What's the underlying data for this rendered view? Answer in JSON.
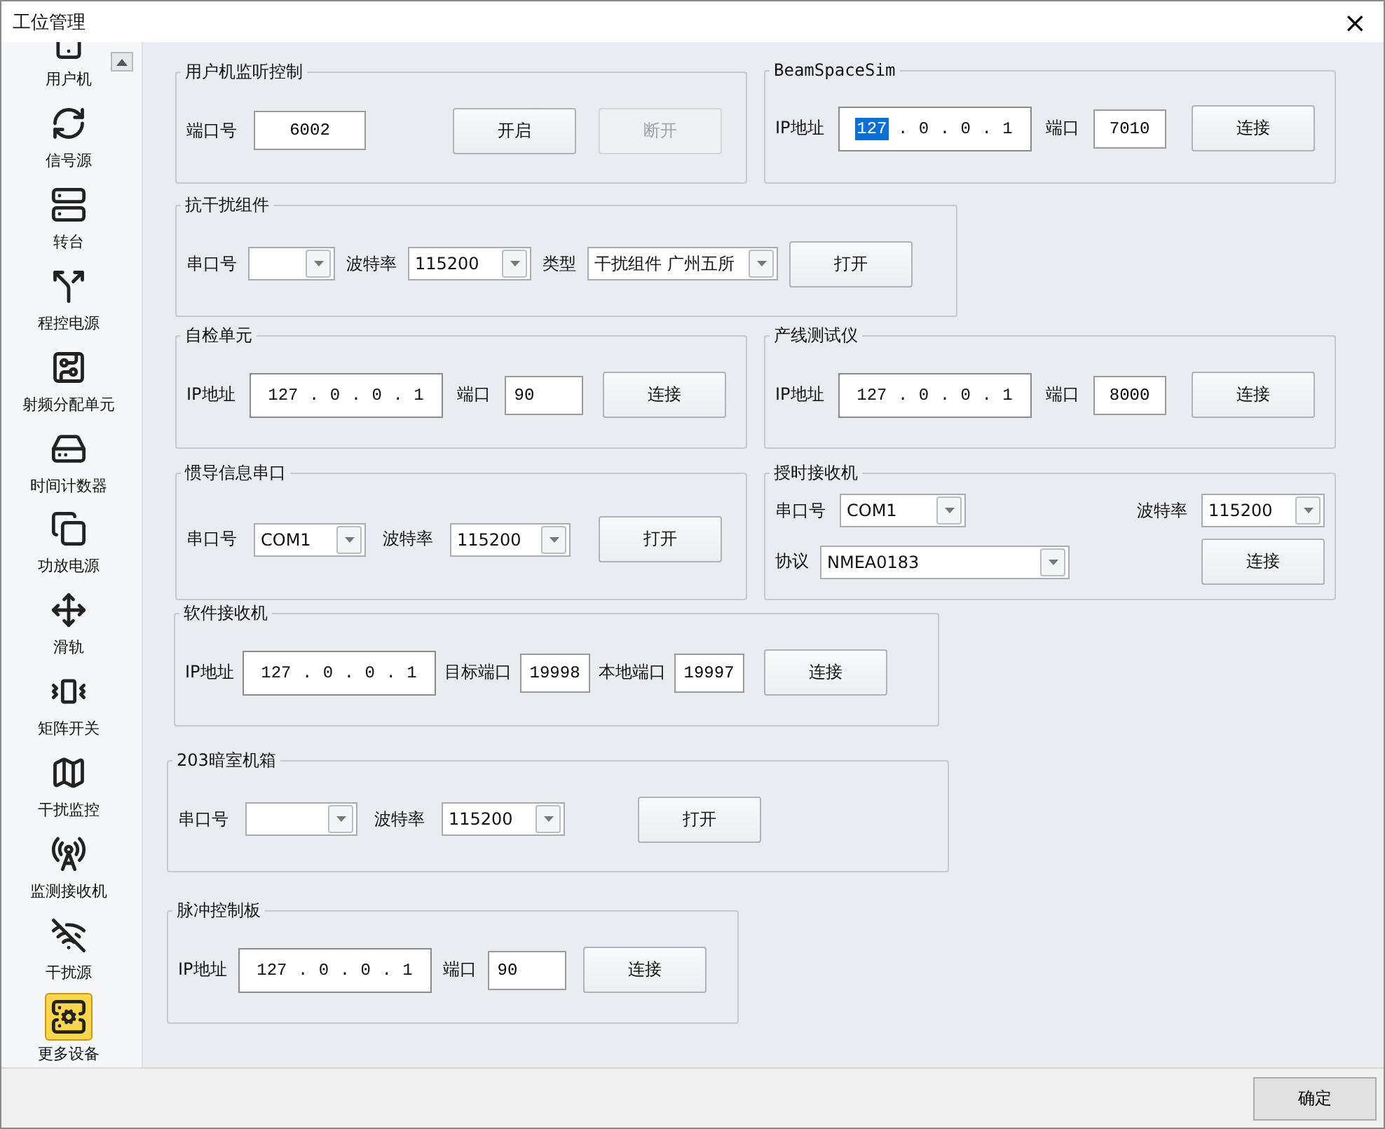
{
  "window": {
    "title": "工位管理",
    "close": "×"
  },
  "sidebar": {
    "items": [
      {
        "label": "用户机",
        "selected": false
      },
      {
        "label": "信号源",
        "selected": false
      },
      {
        "label": "转台",
        "selected": false
      },
      {
        "label": "程控电源",
        "selected": false
      },
      {
        "label": "射频分配单元",
        "selected": false
      },
      {
        "label": "时间计数器",
        "selected": false
      },
      {
        "label": "功放电源",
        "selected": false
      },
      {
        "label": "滑轨",
        "selected": false
      },
      {
        "label": "矩阵开关",
        "selected": false
      },
      {
        "label": "干扰监控",
        "selected": false
      },
      {
        "label": "监测接收机",
        "selected": false
      },
      {
        "label": "干扰源",
        "selected": false
      },
      {
        "label": "更多设备",
        "selected": true
      }
    ]
  },
  "panels": [
    {
      "title": "用户机监听控制",
      "rows": [
        [
          {
            "kind": "label",
            "text": "端口号"
          },
          {
            "kind": "text",
            "value": "6002"
          },
          {
            "kind": "button",
            "label": "开启",
            "disabled": false
          },
          {
            "kind": "button",
            "label": "断开",
            "disabled": true
          }
        ]
      ]
    },
    {
      "title": "BeamSpaceSim",
      "rows": [
        [
          {
            "kind": "label",
            "text": "IP地址"
          },
          {
            "kind": "ip",
            "separator": ".",
            "octets": [
              {
                "text": "127",
                "selected": true
              },
              {
                "text": "0",
                "selected": false
              },
              {
                "text": "0",
                "selected": false
              },
              {
                "text": "1",
                "selected": false
              }
            ]
          },
          {
            "kind": "label",
            "text": "端口"
          },
          {
            "kind": "text",
            "value": "7010"
          },
          {
            "kind": "button",
            "label": "连接",
            "disabled": false
          }
        ]
      ]
    },
    {
      "title": "抗干扰组件",
      "rows": [
        [
          {
            "kind": "label",
            "text": "串口号"
          },
          {
            "kind": "combo"
          },
          {
            "kind": "label",
            "text": "波特率"
          },
          {
            "kind": "combo",
            "value": "115200"
          },
          {
            "kind": "label",
            "text": "类型"
          },
          {
            "kind": "combo",
            "value": "干扰组件 广州五所"
          },
          {
            "kind": "button",
            "label": "打开",
            "disabled": false
          }
        ]
      ]
    },
    {
      "title": "自检单元",
      "rows": [
        [
          {
            "kind": "label",
            "text": "IP地址"
          },
          {
            "kind": "ip",
            "separator": ".",
            "octets": [
              {
                "text": "127",
                "selected": false
              },
              {
                "text": "0",
                "selected": false
              },
              {
                "text": "0",
                "selected": false
              },
              {
                "text": "1",
                "selected": false
              }
            ]
          },
          {
            "kind": "label",
            "text": "端口"
          },
          {
            "kind": "text",
            "value": "90"
          },
          {
            "kind": "button",
            "label": "连接",
            "disabled": false
          }
        ]
      ]
    },
    {
      "title": "产线测试仪",
      "rows": [
        [
          {
            "kind": "label",
            "text": "IP地址"
          },
          {
            "kind": "ip",
            "separator": ".",
            "octets": [
              {
                "text": "127",
                "selected": false
              },
              {
                "text": "0",
                "selected": false
              },
              {
                "text": "0",
                "selected": false
              },
              {
                "text": "1",
                "selected": false
              }
            ]
          },
          {
            "kind": "label",
            "text": "端口"
          },
          {
            "kind": "text",
            "value": "8000"
          },
          {
            "kind": "button",
            "label": "连接",
            "disabled": false
          }
        ]
      ]
    },
    {
      "title": "惯导信息串口",
      "rows": [
        [
          {
            "kind": "label",
            "text": "串口号"
          },
          {
            "kind": "combo",
            "value": "COM1"
          },
          {
            "kind": "label",
            "text": "波特率"
          },
          {
            "kind": "combo",
            "value": "115200"
          },
          {
            "kind": "button",
            "label": "打开",
            "disabled": false
          }
        ]
      ]
    },
    {
      "title": "授时接收机",
      "rows": [
        [
          {
            "kind": "label",
            "text": "串口号"
          },
          {
            "kind": "combo",
            "value": "COM1"
          },
          {
            "kind": "label",
            "text": "波特率"
          },
          {
            "kind": "combo",
            "value": "115200"
          }
        ],
        [
          {
            "kind": "label",
            "text": "协议"
          },
          {
            "kind": "combo",
            "value": "NMEA0183"
          },
          {
            "kind": "spacer"
          },
          {
            "kind": "button",
            "label": "连接",
            "disabled": false
          }
        ]
      ]
    },
    {
      "title": "软件接收机",
      "rows": [
        [
          {
            "kind": "label",
            "text": "IP地址"
          },
          {
            "kind": "ip",
            "separator": ".",
            "octets": [
              {
                "text": "127",
                "selected": false
              },
              {
                "text": "0",
                "selected": false
              },
              {
                "text": "0",
                "selected": false
              },
              {
                "text": "1",
                "selected": false
              }
            ]
          },
          {
            "kind": "label",
            "text": "目标端口"
          },
          {
            "kind": "text",
            "value": "19998"
          },
          {
            "kind": "label",
            "text": "本地端口"
          },
          {
            "kind": "text",
            "value": "19997"
          },
          {
            "kind": "button",
            "label": "连接",
            "disabled": false
          }
        ]
      ]
    },
    {
      "title": "203暗室机箱",
      "rows": [
        [
          {
            "kind": "label",
            "text": "串口号"
          },
          {
            "kind": "combo"
          },
          {
            "kind": "label",
            "text": "波特率"
          },
          {
            "kind": "combo",
            "value": "115200"
          },
          {
            "kind": "button",
            "label": "打开",
            "disabled": false
          }
        ]
      ]
    },
    {
      "title": "脉冲控制板",
      "rows": [
        [
          {
            "kind": "label",
            "text": "IP地址"
          },
          {
            "kind": "ip",
            "separator": ".",
            "octets": [
              {
                "text": "127",
                "selected": false
              },
              {
                "text": "0",
                "selected": false
              },
              {
                "text": "0",
                "selected": false
              },
              {
                "text": "1",
                "selected": false
              }
            ]
          },
          {
            "kind": "label",
            "text": "端口"
          },
          {
            "kind": "text",
            "value": "90"
          },
          {
            "kind": "button",
            "label": "连接",
            "disabled": false
          }
        ]
      ]
    }
  ],
  "footer": {
    "ok_button": "确定"
  }
}
